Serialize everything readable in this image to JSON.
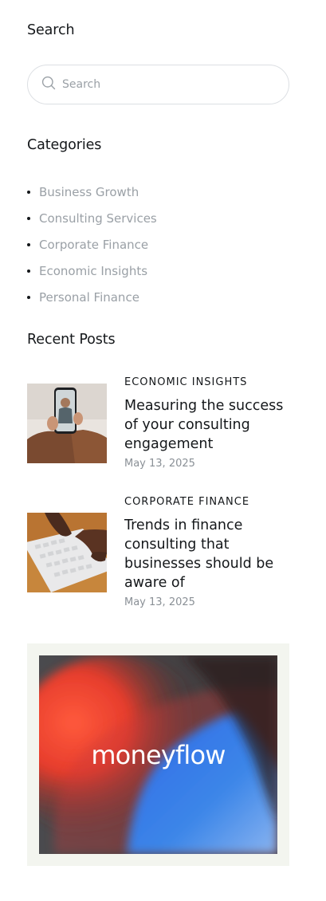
{
  "search": {
    "title": "Search",
    "placeholder": "Search",
    "icon": "search-icon"
  },
  "categories": {
    "title": "Categories",
    "items": [
      {
        "label": "Business Growth"
      },
      {
        "label": "Consulting Services"
      },
      {
        "label": "Corporate Finance"
      },
      {
        "label": "Economic Insights"
      },
      {
        "label": "Personal Finance"
      }
    ]
  },
  "recent_posts": {
    "title": "Recent Posts",
    "items": [
      {
        "category": "ECONOMIC INSIGHTS",
        "title": "Measuring the success of your consulting engagement",
        "date": "May 13, 2025"
      },
      {
        "category": "CORPORATE FINANCE",
        "title": "Trends in finance consulting that businesses should be aware of",
        "date": "May 13, 2025"
      }
    ]
  },
  "ad": {
    "brand": "moneyflow"
  },
  "colors": {
    "text": "#14171a",
    "muted": "#9aa0a6",
    "ad_bg": "#f3f5ef"
  }
}
